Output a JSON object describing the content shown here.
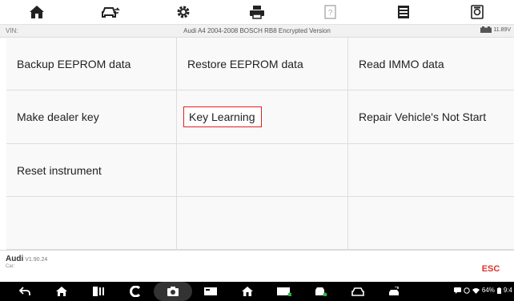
{
  "toolbar": {
    "items": [
      {
        "icon": "home-icon"
      },
      {
        "icon": "vehicle-swap-icon"
      },
      {
        "icon": "settings-icon"
      },
      {
        "icon": "print-icon"
      },
      {
        "icon": "help-icon"
      },
      {
        "icon": "data-log-icon"
      },
      {
        "icon": "screenshot-icon"
      }
    ]
  },
  "infobar": {
    "vin_label": "VIN:",
    "title": "Audi A4 2004-2008 BOSCH RB8 Encrypted Version",
    "battery_voltage": "11.89V"
  },
  "menu": {
    "items": [
      {
        "label": "Backup EEPROM data"
      },
      {
        "label": "Restore EEPROM data"
      },
      {
        "label": "Read IMMO data"
      },
      {
        "label": "Make dealer key"
      },
      {
        "label": "Key Learning"
      },
      {
        "label": "Repair Vehicle's Not Start"
      },
      {
        "label": "Reset instrument"
      },
      {
        "label": ""
      },
      {
        "label": ""
      },
      {
        "label": ""
      },
      {
        "label": ""
      },
      {
        "label": ""
      }
    ]
  },
  "footer": {
    "brand": "Audi",
    "version": "V1.90.24",
    "car_label": "Car:",
    "esc_label": "ESC"
  },
  "statusbar": {
    "battery": "64%",
    "time": "9:4"
  },
  "colors": {
    "accent": "#e0302f",
    "highlight_border": "#e02020"
  }
}
